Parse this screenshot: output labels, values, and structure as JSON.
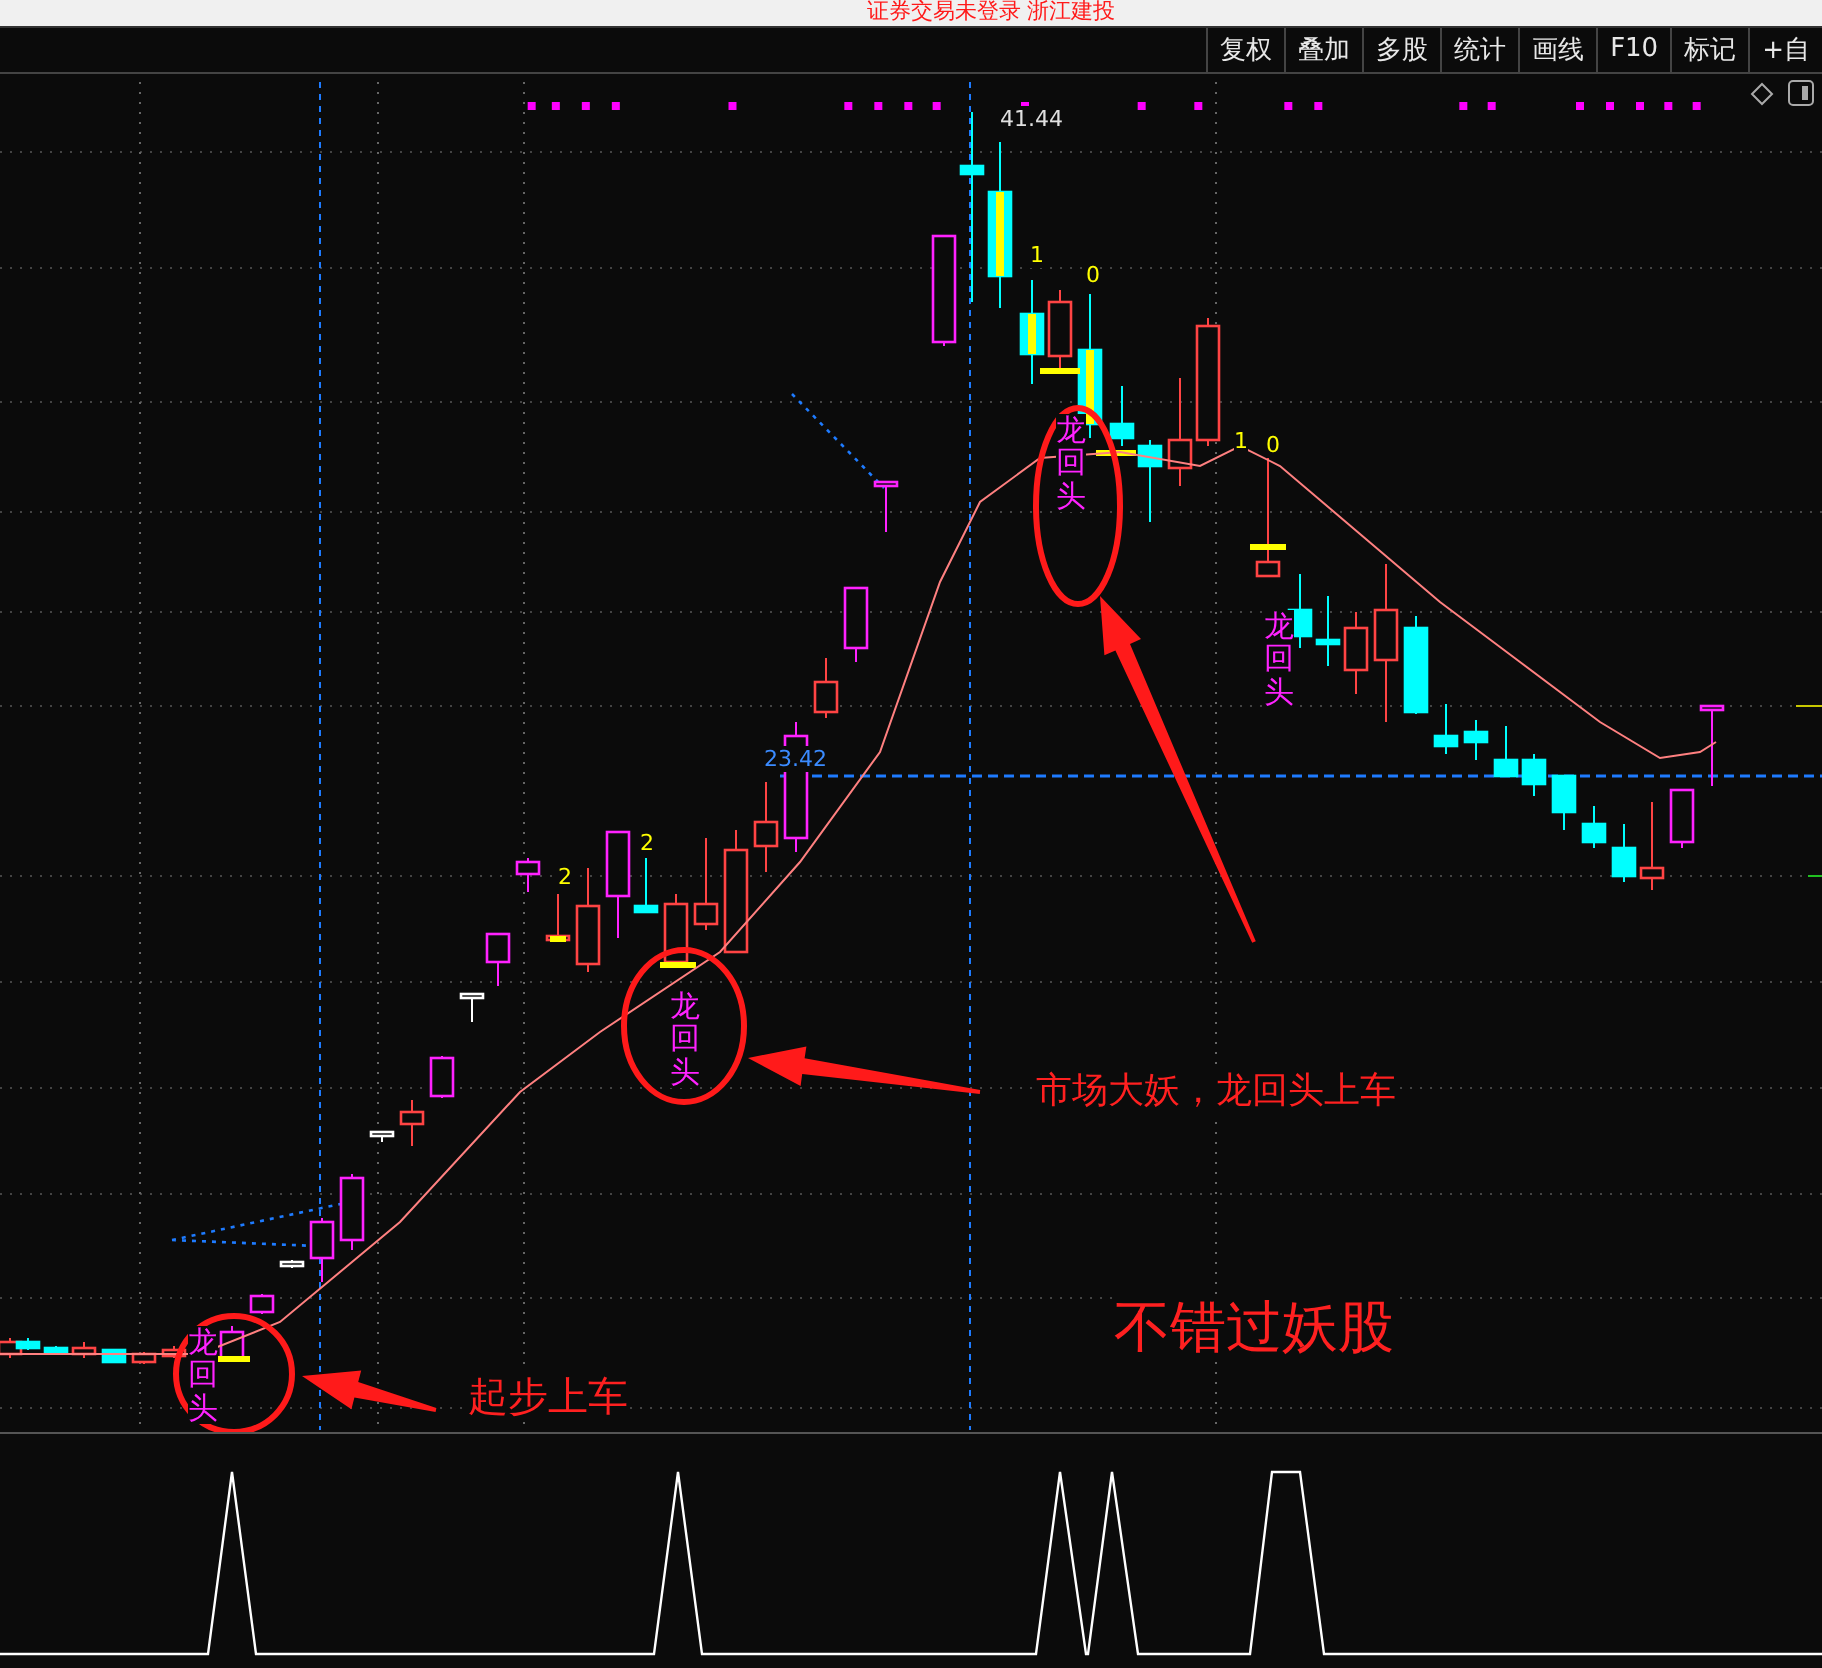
{
  "top_banner": "证券交易未登录  浙江建投",
  "toolbar": [
    "复权",
    "叠加",
    "多股",
    "统计",
    "画线",
    "F10",
    "标记",
    "+自"
  ],
  "chart": {
    "price_labels": [
      "41.44",
      "23.42"
    ],
    "signals": [
      "2",
      "2",
      "1",
      "0",
      "1",
      "0"
    ],
    "pattern_labels": [
      "龙回头",
      "龙回头",
      "龙回头",
      "龙回头"
    ],
    "callouts": [
      "起步上车",
      "市场大妖，龙回头上车"
    ],
    "headline": "不错过妖股"
  }
}
